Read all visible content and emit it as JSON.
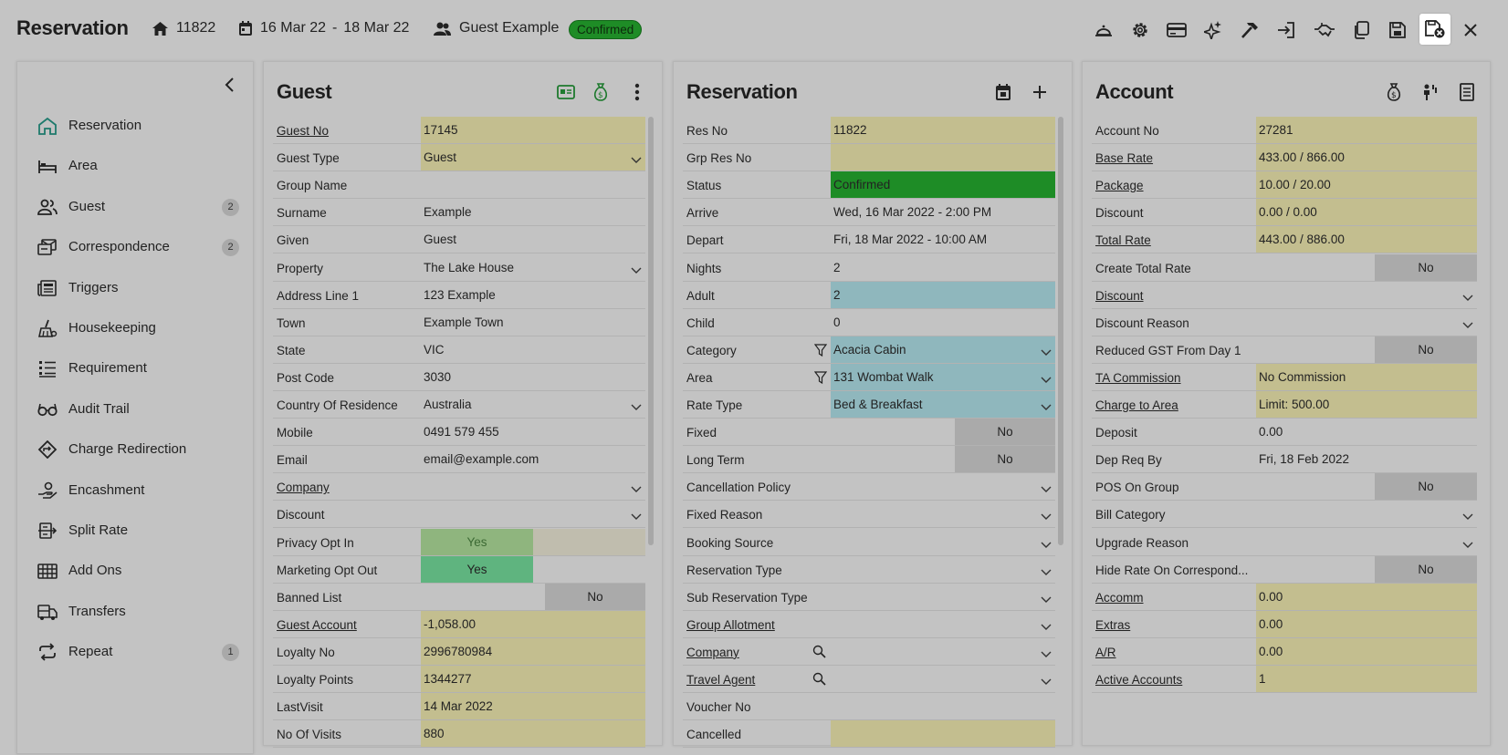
{
  "header": {
    "title": "Reservation",
    "res_no": "11822",
    "date_from": "16 Mar 22",
    "date_sep": "-",
    "date_to": "18 Mar 22",
    "guest": "Guest Example",
    "status_badge": "Confirmed",
    "toolbar_icons": [
      "bell-icon",
      "gear-icon",
      "credit-card-icon",
      "sparkle-icon",
      "hammer-icon",
      "sign-in-icon",
      "handshake-icon",
      "copy-icon",
      "save-icon",
      "save-close-icon",
      "close-icon"
    ]
  },
  "sidebar": {
    "items": [
      {
        "label": "Reservation",
        "icon": "home-icon",
        "count": ""
      },
      {
        "label": "Area",
        "icon": "bed-icon",
        "count": ""
      },
      {
        "label": "Guest",
        "icon": "users-icon",
        "count": "2"
      },
      {
        "label": "Correspondence",
        "icon": "mail-stack-icon",
        "count": "2"
      },
      {
        "label": "Triggers",
        "icon": "newspaper-icon",
        "count": ""
      },
      {
        "label": "Housekeeping",
        "icon": "broom-icon",
        "count": ""
      },
      {
        "label": "Requirement",
        "icon": "list-icon",
        "count": ""
      },
      {
        "label": "Audit Trail",
        "icon": "glasses-icon",
        "count": ""
      },
      {
        "label": "Charge Redirection",
        "icon": "diamond-arrow-icon",
        "count": ""
      },
      {
        "label": "Encashment",
        "icon": "hand-coin-icon",
        "count": ""
      },
      {
        "label": "Split Rate",
        "icon": "split-icon",
        "count": ""
      },
      {
        "label": "Add Ons",
        "icon": "grid-icon",
        "count": ""
      },
      {
        "label": "Transfers",
        "icon": "bus-icon",
        "count": ""
      },
      {
        "label": "Repeat",
        "icon": "repeat-icon",
        "count": "1"
      }
    ]
  },
  "guest": {
    "title": "Guest",
    "rows": [
      {
        "k": "Guest No",
        "v": "17145",
        "link": true,
        "style": "y"
      },
      {
        "k": "Guest Type",
        "v": "Guest",
        "style": "y",
        "dd": true
      },
      {
        "k": "Group Name",
        "v": ""
      },
      {
        "k": "Surname",
        "v": "Example"
      },
      {
        "k": "Given",
        "v": "Guest"
      },
      {
        "k": "Property",
        "v": "The Lake House",
        "dd": true
      },
      {
        "k": "Address Line 1",
        "v": "123 Example"
      },
      {
        "k": "Town",
        "v": "Example Town"
      },
      {
        "k": "State",
        "v": "VIC"
      },
      {
        "k": "Post Code",
        "v": "3030"
      },
      {
        "k": "Country Of Residence",
        "v": "Australia",
        "dd": true
      },
      {
        "k": "Mobile",
        "v": "0491 579 455"
      },
      {
        "k": "Email",
        "v": "email@example.com"
      },
      {
        "k": "Company",
        "v": "",
        "link": true,
        "dd": true
      },
      {
        "k": "Discount",
        "v": "",
        "dd": true
      },
      {
        "k": "Privacy Opt In",
        "v": "Yes",
        "toggle": "light"
      },
      {
        "k": "Marketing Opt Out",
        "v": "Yes",
        "toggle": "green"
      },
      {
        "k": "Banned List",
        "v": "No",
        "toggle": "no"
      },
      {
        "k": "Guest Account",
        "v": "-1,058.00",
        "link": true,
        "style": "y"
      },
      {
        "k": "Loyalty No",
        "v": "2996780984",
        "style": "y"
      },
      {
        "k": "Loyalty Points",
        "v": "1344277",
        "style": "y"
      },
      {
        "k": "LastVisit",
        "v": "14 Mar 2022",
        "style": "y"
      },
      {
        "k": "No Of Visits",
        "v": "880",
        "style": "y"
      }
    ]
  },
  "reservation": {
    "title": "Reservation",
    "rows": [
      {
        "k": "Res No",
        "v": "11822",
        "style": "y"
      },
      {
        "k": "Grp Res No",
        "v": "",
        "style": "y"
      },
      {
        "k": "Status",
        "v": "Confirmed",
        "style": "g"
      },
      {
        "k": "Arrive",
        "v": "Wed, 16 Mar 2022 - 2:00 PM"
      },
      {
        "k": "Depart",
        "v": "Fri, 18 Mar 2022 - 10:00 AM"
      },
      {
        "k": "Nights",
        "v": "2"
      },
      {
        "k": "Adult",
        "v": "2",
        "style": "b"
      },
      {
        "k": "Child",
        "v": "0"
      },
      {
        "k": "Category",
        "v": "Acacia Cabin",
        "style": "b",
        "dd": true,
        "filter": true
      },
      {
        "k": "Area",
        "v": "131 Wombat Walk",
        "style": "b",
        "dd": true,
        "filter": true
      },
      {
        "k": "Rate Type",
        "v": "Bed & Breakfast",
        "style": "b",
        "dd": true
      },
      {
        "k": "Fixed",
        "v": "No",
        "toggle": "no"
      },
      {
        "k": "Long Term",
        "v": "No",
        "toggle": "no"
      },
      {
        "k": "Cancellation Policy",
        "v": "",
        "dd": true
      },
      {
        "k": "Fixed Reason",
        "v": "",
        "dd": true
      },
      {
        "k": "Booking Source",
        "v": "",
        "dd": true
      },
      {
        "k": "Reservation Type",
        "v": "",
        "dd": true
      },
      {
        "k": "Sub Reservation Type",
        "v": "",
        "dd": true
      },
      {
        "k": "Group Allotment",
        "v": "",
        "link": true,
        "dd": true
      },
      {
        "k": "Company",
        "v": "",
        "link": true,
        "dd": true,
        "search": true
      },
      {
        "k": "Travel Agent",
        "v": "",
        "link": true,
        "dd": true,
        "search": true
      },
      {
        "k": "Voucher No",
        "v": ""
      },
      {
        "k": "Cancelled",
        "v": "",
        "style": "y"
      }
    ]
  },
  "account": {
    "title": "Account",
    "rows": [
      {
        "k": "Account No",
        "v": "27281",
        "style": "y"
      },
      {
        "k": "Base Rate",
        "v": "433.00 / 866.00",
        "link": true,
        "style": "y"
      },
      {
        "k": "Package",
        "v": "10.00 / 20.00",
        "link": true,
        "style": "y"
      },
      {
        "k": "Discount",
        "v": "0.00 / 0.00",
        "style": "y"
      },
      {
        "k": "Total Rate",
        "v": "443.00 / 886.00",
        "link": true,
        "style": "y"
      },
      {
        "k": "Create Total Rate",
        "v": "No",
        "toggle": "no"
      },
      {
        "k": "Discount",
        "v": "",
        "link": true,
        "dd": true
      },
      {
        "k": "Discount Reason",
        "v": "",
        "dd": true
      },
      {
        "k": "Reduced GST From Day 1",
        "v": "No",
        "toggle": "no"
      },
      {
        "k": "TA Commission",
        "v": "No Commission",
        "link": true,
        "style": "y"
      },
      {
        "k": "Charge to Area",
        "v": "Limit: 500.00",
        "link": true,
        "style": "y"
      },
      {
        "k": "Deposit",
        "v": "0.00"
      },
      {
        "k": "Dep Req By",
        "v": "Fri, 18 Feb 2022"
      },
      {
        "k": "POS On Group",
        "v": "No",
        "toggle": "no"
      },
      {
        "k": "Bill Category",
        "v": "",
        "dd": true
      },
      {
        "k": "Upgrade Reason",
        "v": "",
        "dd": true
      },
      {
        "k": "Hide Rate On Correspond...",
        "v": "No",
        "toggle": "no"
      },
      {
        "k": "Accomm",
        "v": "0.00",
        "link": true,
        "style": "y"
      },
      {
        "k": "Extras",
        "v": "0.00",
        "link": true,
        "style": "y"
      },
      {
        "k": "A/R",
        "v": "0.00",
        "link": true,
        "style": "y"
      },
      {
        "k": "Active Accounts",
        "v": "1",
        "link": true,
        "style": "y"
      }
    ]
  },
  "colors": {
    "background": "#c4c4c4",
    "yellow_field": "#c3be8f",
    "blue_field": "#8fb7bd",
    "green_status": "#1e8c26",
    "toggle_no": "#aaaaaa"
  }
}
